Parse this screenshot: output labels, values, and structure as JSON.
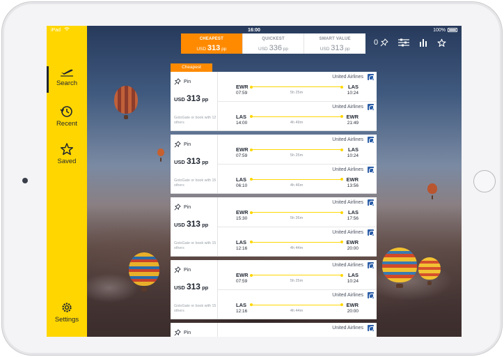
{
  "status_bar": {
    "carrier": "iPad",
    "time": "16:00",
    "battery": "100%"
  },
  "sidebar": {
    "items": [
      {
        "label": "Search",
        "icon": "plane-icon"
      },
      {
        "label": "Recent",
        "icon": "history-icon"
      },
      {
        "label": "Saved",
        "icon": "star-icon"
      },
      {
        "label": "Settings",
        "icon": "gear-icon"
      }
    ]
  },
  "sort_tabs": [
    {
      "label": "CHEAPEST",
      "currency": "USD",
      "price": "313",
      "unit": "pp",
      "active": true
    },
    {
      "label": "QUICKEST",
      "currency": "USD",
      "price": "336",
      "unit": "pp",
      "active": false
    },
    {
      "label": "SMART VALUE",
      "currency": "USD",
      "price": "313",
      "unit": "pp",
      "active": false
    }
  ],
  "tools": {
    "pin_count": "0"
  },
  "results_tag": "Cheapest",
  "colors": {
    "accent": "#ffd600",
    "active_tab": "#ff8a00",
    "text_dark": "#1f2530"
  },
  "results": [
    {
      "pin_label": "Pin",
      "currency": "USD",
      "price": "313",
      "unit": "pp",
      "book_note": "GotoGate or book with 12 others",
      "legs": [
        {
          "airline": "United Airlines",
          "from": "EWR",
          "to": "LAS",
          "depart": "07:59",
          "arrive": "10:24",
          "duration": "5h 25m"
        },
        {
          "airline": "United Airlines",
          "from": "LAS",
          "to": "EWR",
          "depart": "14:00",
          "arrive": "21:49",
          "duration": "4h 49m"
        }
      ]
    },
    {
      "pin_label": "Pin",
      "currency": "USD",
      "price": "313",
      "unit": "pp",
      "book_note": "GotoGate or book with 15 others",
      "legs": [
        {
          "airline": "United Airlines",
          "from": "EWR",
          "to": "LAS",
          "depart": "07:59",
          "arrive": "10:24",
          "duration": "5h 25m"
        },
        {
          "airline": "United Airlines",
          "from": "LAS",
          "to": "EWR",
          "depart": "06:10",
          "arrive": "13:56",
          "duration": "4h 46m"
        }
      ]
    },
    {
      "pin_label": "Pin",
      "currency": "USD",
      "price": "313",
      "unit": "pp",
      "book_note": "GotoGate or book with 15 others",
      "legs": [
        {
          "airline": "United Airlines",
          "from": "EWR",
          "to": "LAS",
          "depart": "15:30",
          "arrive": "17:56",
          "duration": "5h 26m"
        },
        {
          "airline": "United Airlines",
          "from": "LAS",
          "to": "EWR",
          "depart": "12:16",
          "arrive": "20:00",
          "duration": "4h 44m"
        }
      ]
    },
    {
      "pin_label": "Pin",
      "currency": "USD",
      "price": "313",
      "unit": "pp",
      "book_note": "GotoGate or book with 15 others",
      "legs": [
        {
          "airline": "United Airlines",
          "from": "EWR",
          "to": "LAS",
          "depart": "07:59",
          "arrive": "10:24",
          "duration": "5h 25m"
        },
        {
          "airline": "United Airlines",
          "from": "LAS",
          "to": "EWR",
          "depart": "12:16",
          "arrive": "20:00",
          "duration": "4h 44m"
        }
      ]
    },
    {
      "pin_label": "Pin",
      "legs": [
        {
          "airline": "United Airlines"
        }
      ]
    }
  ]
}
